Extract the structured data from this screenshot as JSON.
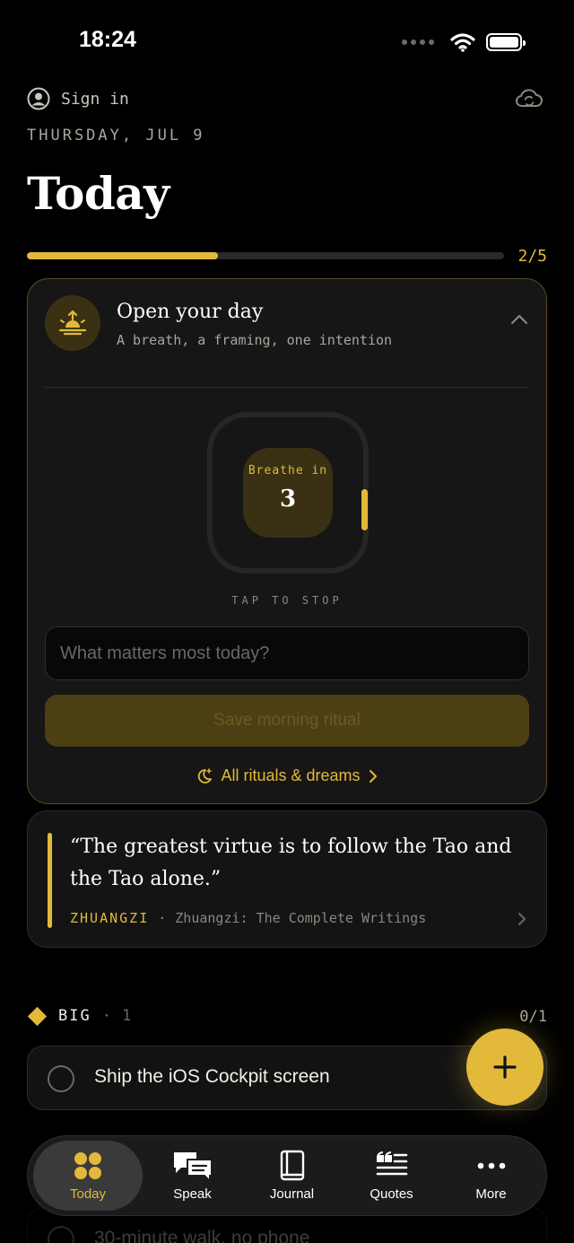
{
  "status": {
    "time": "18:24"
  },
  "header": {
    "sign_in": "Sign in",
    "date": "THURSDAY, JUL 9",
    "title": "Today",
    "progress_label": "2/5",
    "progress_fraction": 0.4
  },
  "ritual": {
    "title": "Open your day",
    "subtitle": "A breath, a framing, one intention",
    "breath_label": "Breathe in",
    "breath_count": "3",
    "tap_hint": "TAP TO STOP",
    "intention_placeholder": "What matters most today?",
    "save_label": "Save morning ritual",
    "all_link": "All rituals & dreams"
  },
  "quote": {
    "text": "“The greatest virtue is to follow the Tao and the Tao alone.”",
    "author": "ZHUANGZI",
    "separator": "·",
    "source": "Zhuangzi: The Complete Writings"
  },
  "big": {
    "title": "BIG",
    "separator": "·",
    "count": "1",
    "progress": "0/1",
    "task": "Ship the iOS Cockpit screen"
  },
  "next_task": "30-minute walk, no phone",
  "tabs": [
    {
      "label": "Today",
      "icon": "dots-grid-icon",
      "active": true
    },
    {
      "label": "Speak",
      "icon": "speech-bubbles-icon"
    },
    {
      "label": "Journal",
      "icon": "book-icon"
    },
    {
      "label": "Quotes",
      "icon": "quote-icon"
    },
    {
      "label": "More",
      "icon": "ellipsis-icon"
    }
  ],
  "colors": {
    "accent": "#e2b93b",
    "background": "#000000",
    "card": "#161616"
  }
}
